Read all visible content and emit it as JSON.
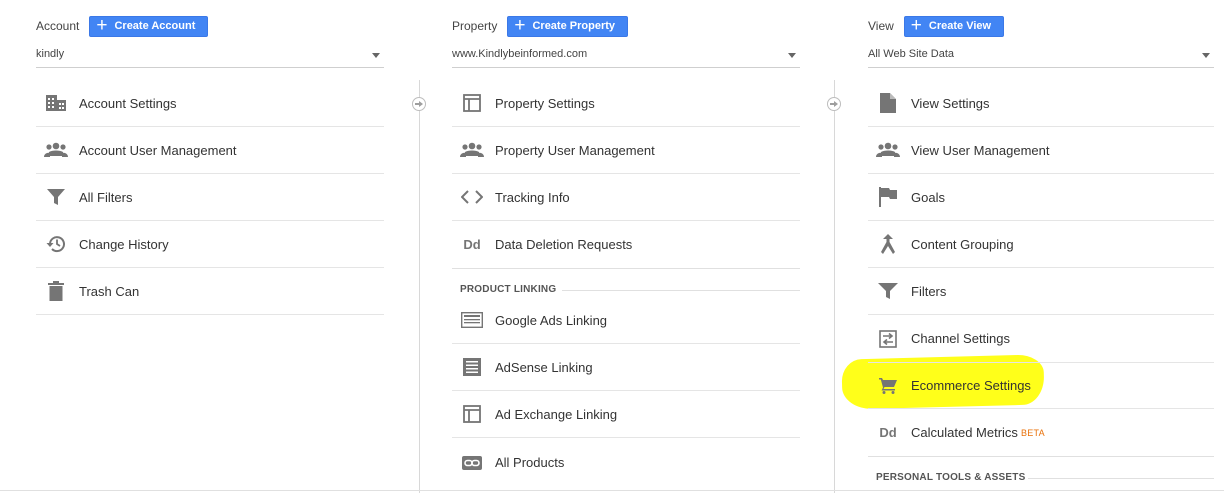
{
  "account": {
    "label": "Account",
    "create_label": "Create Account",
    "selected": "kindly",
    "items": [
      {
        "label": "Account Settings"
      },
      {
        "label": "Account User Management"
      },
      {
        "label": "All Filters"
      },
      {
        "label": "Change History"
      },
      {
        "label": "Trash Can"
      }
    ]
  },
  "property": {
    "label": "Property",
    "create_label": "Create Property",
    "selected": "www.Kindlybeinformed.com",
    "items": [
      {
        "label": "Property Settings"
      },
      {
        "label": "Property User Management"
      },
      {
        "label": "Tracking Info"
      },
      {
        "label": "Data Deletion Requests"
      }
    ],
    "section_title": "PRODUCT LINKING",
    "linking_items": [
      {
        "label": "Google Ads Linking"
      },
      {
        "label": "AdSense Linking"
      },
      {
        "label": "Ad Exchange Linking"
      },
      {
        "label": "All Products"
      }
    ]
  },
  "view": {
    "label": "View",
    "create_label": "Create View",
    "selected": "All Web Site Data",
    "items": [
      {
        "label": "View Settings"
      },
      {
        "label": "View User Management"
      },
      {
        "label": "Goals"
      },
      {
        "label": "Content Grouping"
      },
      {
        "label": "Filters"
      },
      {
        "label": "Channel Settings"
      },
      {
        "label": "Ecommerce Settings"
      },
      {
        "label": "Calculated Metrics",
        "badge": "BETA"
      }
    ],
    "section_title": "PERSONAL TOOLS & ASSETS"
  },
  "colors": {
    "accent": "#4285f4",
    "highlight": "#ffff1a",
    "beta": "#e8710a",
    "icon": "#757575"
  }
}
